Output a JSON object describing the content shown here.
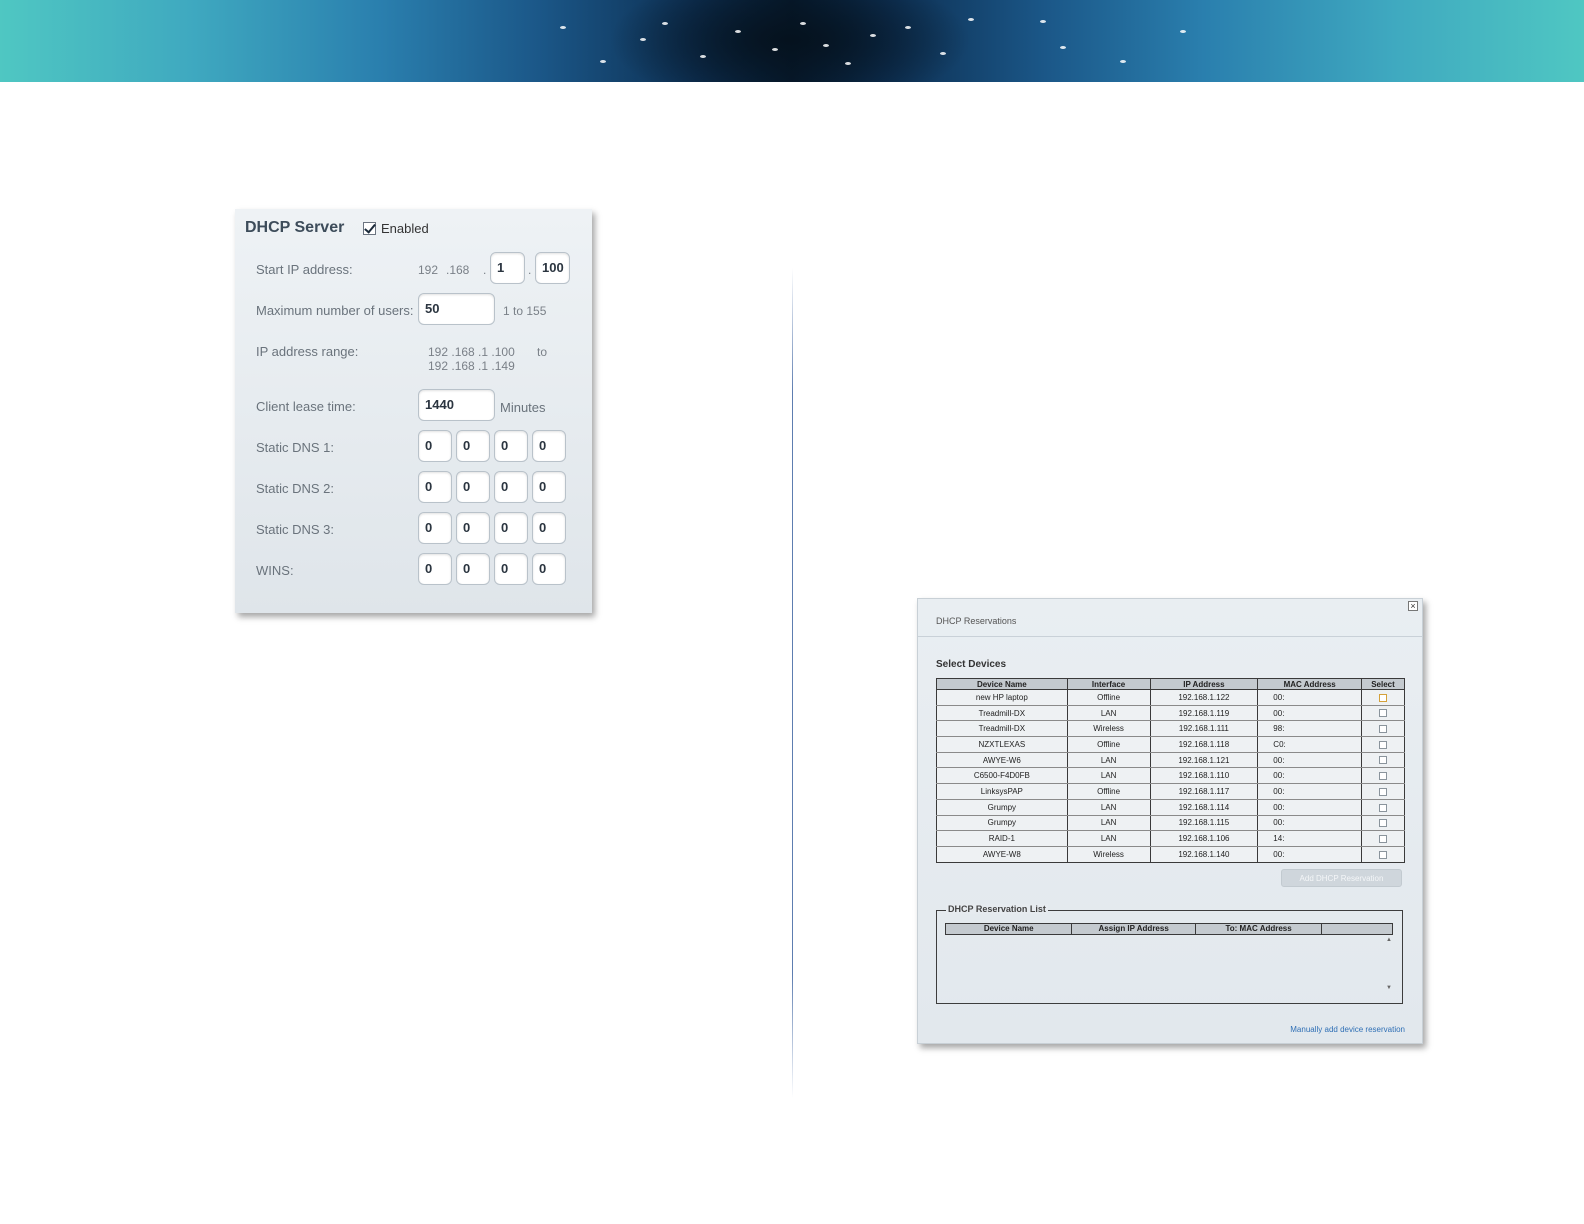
{
  "dhcp_server": {
    "title": "DHCP Server",
    "enabled_label": "Enabled",
    "enabled": true,
    "start_ip": {
      "label": "Start IP address:",
      "octet1": "192",
      "octet2": ".168",
      "sep": ".",
      "octet3": "1",
      "sep2": ".",
      "octet4": "100"
    },
    "max_users": {
      "label": "Maximum number of users:",
      "value": "50",
      "hint": "1 to 155"
    },
    "ip_range": {
      "label": "IP address range:",
      "line1": "192 .168 .1 .100",
      "to": "to",
      "line2": "192 .168 .1 .149"
    },
    "lease_time": {
      "label": "Client lease time:",
      "value": "1440",
      "unit": "Minutes"
    },
    "dns1": {
      "label": "Static DNS 1:",
      "octets": [
        "0",
        "0",
        "0",
        "0"
      ]
    },
    "dns2": {
      "label": "Static DNS 2:",
      "octets": [
        "0",
        "0",
        "0",
        "0"
      ]
    },
    "dns3": {
      "label": "Static DNS 3:",
      "octets": [
        "0",
        "0",
        "0",
        "0"
      ]
    },
    "wins": {
      "label": "WINS:",
      "octets": [
        "0",
        "0",
        "0",
        "0"
      ]
    }
  },
  "reservations": {
    "title": "DHCP Reservations",
    "close_symbol": "×",
    "select_devices_title": "Select Devices",
    "columns": [
      "Device Name",
      "Interface",
      "IP Address",
      "MAC Address",
      "Select"
    ],
    "rows": [
      {
        "name": "new HP laptop",
        "interface": "Offline",
        "ip": "192.168.1.122",
        "mac": "00:"
      },
      {
        "name": "Treadmill-DX",
        "interface": "LAN",
        "ip": "192.168.1.119",
        "mac": "00:"
      },
      {
        "name": "Treadmill-DX",
        "interface": "Wireless",
        "ip": "192.168.1.111",
        "mac": "98:"
      },
      {
        "name": "NZXTLEXAS",
        "interface": "Offline",
        "ip": "192.168.1.118",
        "mac": "C0:"
      },
      {
        "name": "AWYE-W6",
        "interface": "LAN",
        "ip": "192.168.1.121",
        "mac": "00:"
      },
      {
        "name": "C6500-F4D0FB",
        "interface": "LAN",
        "ip": "192.168.1.110",
        "mac": "00:"
      },
      {
        "name": "LinksysPAP",
        "interface": "Offline",
        "ip": "192.168.1.117",
        "mac": "00:"
      },
      {
        "name": "Grumpy",
        "interface": "LAN",
        "ip": "192.168.1.114",
        "mac": "00:"
      },
      {
        "name": "Grumpy",
        "interface": "LAN",
        "ip": "192.168.1.115",
        "mac": "00:"
      },
      {
        "name": "RAID-1",
        "interface": "LAN",
        "ip": "192.168.1.106",
        "mac": "14:"
      },
      {
        "name": "AWYE-W8",
        "interface": "Wireless",
        "ip": "192.168.1.140",
        "mac": "00:"
      }
    ],
    "add_button": "Add DHCP Reservation",
    "list_title": "DHCP Reservation List",
    "list_columns": [
      "Device Name",
      "Assign IP Address",
      "To: MAC Address",
      ""
    ],
    "manual_link": "Manually add device reservation"
  }
}
